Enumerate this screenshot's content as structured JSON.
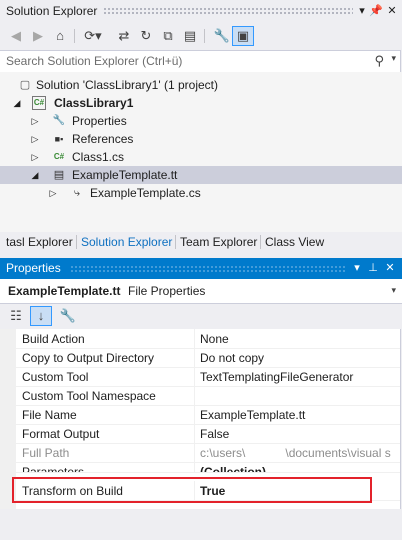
{
  "solution_explorer": {
    "title": "Solution Explorer",
    "search_placeholder": "Search Solution Explorer (Ctrl+ü)",
    "tree": {
      "solution": "Solution 'ClassLibrary1' (1 project)",
      "project": "ClassLibrary1",
      "properties": "Properties",
      "references": "References",
      "class1": "Class1.cs",
      "template": "ExampleTemplate.tt",
      "template_cs": "ExampleTemplate.cs"
    },
    "tabs": [
      "tasl Explorer",
      "Solution Explorer",
      "Team Explorer",
      "Class View"
    ]
  },
  "properties": {
    "title": "Properties",
    "object_name": "ExampleTemplate.tt",
    "object_type": "File Properties",
    "rows": [
      {
        "name": "Build Action",
        "value": "None"
      },
      {
        "name": "Copy to Output Directory",
        "value": "Do not copy"
      },
      {
        "name": "Custom Tool",
        "value": "TextTemplatingFileGenerator"
      },
      {
        "name": "Custom Tool Namespace",
        "value": ""
      },
      {
        "name": "File Name",
        "value": "ExampleTemplate.tt"
      },
      {
        "name": "Format Output",
        "value": "False"
      },
      {
        "name": "Full Path",
        "value": "c:\\users\\            \\documents\\visual s"
      },
      {
        "name": "Parameters",
        "value": "(Collection)"
      },
      {
        "name": "Transform on Build",
        "value": "True"
      }
    ]
  },
  "colors": {
    "accent": "#007acc",
    "highlight": "#e3222b",
    "selection": "#cccedb"
  }
}
